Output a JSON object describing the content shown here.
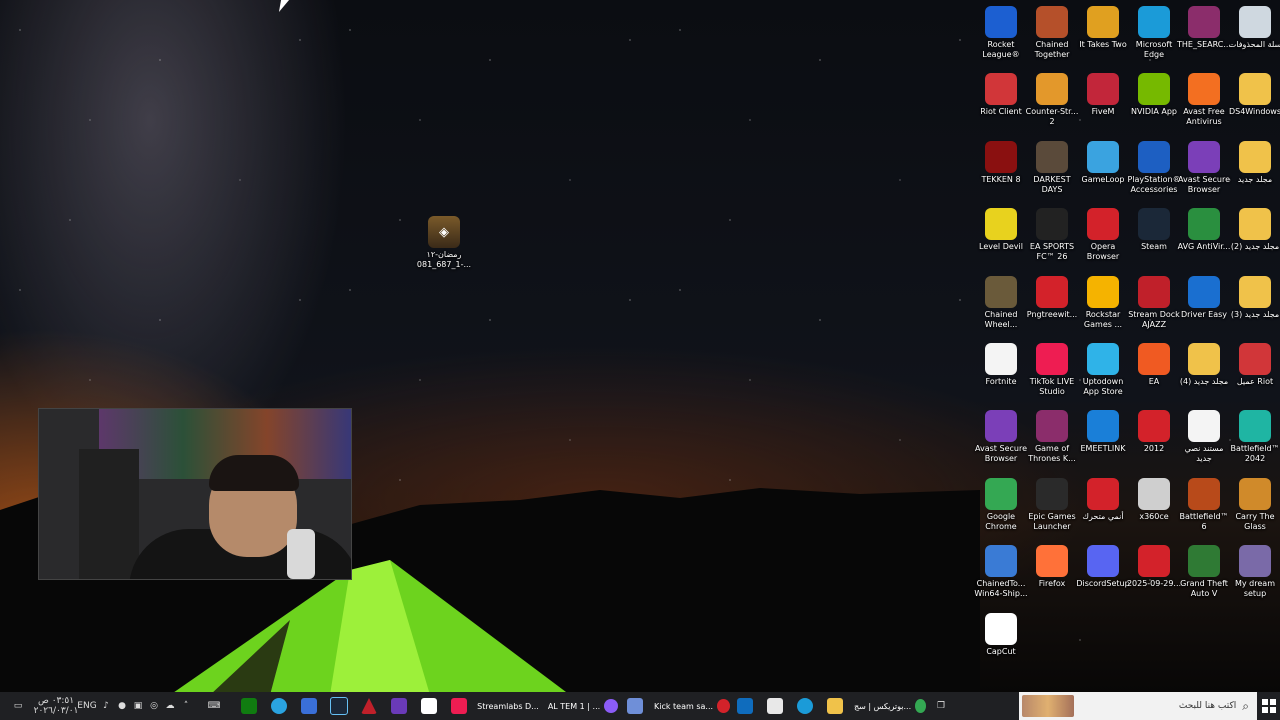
{
  "desktop": {
    "center_file": {
      "label": "رمضان-١٢ -1_687_081...",
      "icon": "image-file-icon"
    },
    "icons": [
      {
        "label": "Rocket League®",
        "icon": "rocket-league-icon",
        "color": "#1c5fd1"
      },
      {
        "label": "Chained Together",
        "icon": "chained-together-icon",
        "color": "#b5502a"
      },
      {
        "label": "It Takes Two",
        "icon": "it-takes-two-icon",
        "color": "#e0a020"
      },
      {
        "label": "Microsoft Edge",
        "icon": "edge-icon",
        "color": "#1b9bd8"
      },
      {
        "label": "THE_SEARC...",
        "icon": "winrar-archive-icon",
        "color": "#8b2d6b"
      },
      {
        "label": "سلة المحذوفات",
        "icon": "recycle-bin-icon",
        "color": "#cfd8e0"
      },
      {
        "label": "Riot Client",
        "icon": "riot-client-icon",
        "color": "#d13639"
      },
      {
        "label": "Counter-Str... 2",
        "icon": "counter-strike-icon",
        "color": "#e3982b"
      },
      {
        "label": "FiveM",
        "icon": "fivem-icon",
        "color": "#c2263a"
      },
      {
        "label": "NVIDIA App",
        "icon": "nvidia-icon",
        "color": "#76b900"
      },
      {
        "label": "Avast Free Antivirus",
        "icon": "avast-icon",
        "color": "#f36f21"
      },
      {
        "label": "DS4Windows",
        "icon": "folder-icon",
        "color": "#f0c24a"
      },
      {
        "label": "TEKKEN 8",
        "icon": "tekken-icon",
        "color": "#8a1010"
      },
      {
        "label": "DARKEST DAYS",
        "icon": "darkest-days-icon",
        "color": "#5a4a3a"
      },
      {
        "label": "GameLoop",
        "icon": "gameloop-icon",
        "color": "#3aa3e0"
      },
      {
        "label": "PlayStation® Accessories",
        "icon": "playstation-icon",
        "color": "#1d5fc2"
      },
      {
        "label": "Avast Secure Browser",
        "icon": "avast-browser-icon",
        "color": "#7b3fb8"
      },
      {
        "label": "مجلد جديد",
        "icon": "folder-icon",
        "color": "#f0c24a"
      },
      {
        "label": "Level Devil",
        "icon": "level-devil-icon",
        "color": "#e8d21e"
      },
      {
        "label": "EA SPORTS FC™ 26",
        "icon": "ea-fc-icon",
        "color": "#222222"
      },
      {
        "label": "Opera Browser",
        "icon": "opera-icon",
        "color": "#d3222a"
      },
      {
        "label": "Steam",
        "icon": "steam-icon",
        "color": "#1b2838"
      },
      {
        "label": "AVG AntiVir...",
        "icon": "avg-icon",
        "color": "#2a8f3f"
      },
      {
        "label": "مجلد جديد (2)",
        "icon": "folder-icon",
        "color": "#f0c24a"
      },
      {
        "label": "Chained Wheel...",
        "icon": "chained-wheel-icon",
        "color": "#6a5a3a"
      },
      {
        "label": "Pngtreewit...",
        "icon": "opera-icon",
        "color": "#d3222a"
      },
      {
        "label": "Rockstar Games ...",
        "icon": "rockstar-icon",
        "color": "#f5b300"
      },
      {
        "label": "Stream Dock AJAZZ",
        "icon": "stream-dock-icon",
        "color": "#c0202a"
      },
      {
        "label": "Driver Easy",
        "icon": "driver-easy-icon",
        "color": "#1a6fd0"
      },
      {
        "label": "مجلد جديد (3)",
        "icon": "folder-icon",
        "color": "#f0c24a"
      },
      {
        "label": "Fortnite",
        "icon": "blank-file-icon",
        "color": "#f4f4f4"
      },
      {
        "label": "TikTok LIVE Studio",
        "icon": "tiktok-icon",
        "color": "#ee1d52"
      },
      {
        "label": "Uptodown App Store",
        "icon": "uptodown-icon",
        "color": "#2fb3e8"
      },
      {
        "label": "EA",
        "icon": "ea-icon",
        "color": "#f05a22"
      },
      {
        "label": "مجلد جديد (4)",
        "icon": "folder-icon",
        "color": "#f0c24a"
      },
      {
        "label": "عميل Riot",
        "icon": "riot-client-icon",
        "color": "#d13639"
      },
      {
        "label": "Avast Secure Browser",
        "icon": "avast-browser-icon",
        "color": "#7b3fb8"
      },
      {
        "label": "Game of Thrones K...",
        "icon": "winrar-archive-icon",
        "color": "#8b2d6b"
      },
      {
        "label": "EMEETLINK",
        "icon": "emeetlink-icon",
        "color": "#1a7fd8"
      },
      {
        "label": "2012",
        "icon": "opera-icon",
        "color": "#d3222a"
      },
      {
        "label": "مستند نصي جديد",
        "icon": "text-file-icon",
        "color": "#f4f4f4"
      },
      {
        "label": "Battlefield™ 2042",
        "icon": "battlefield-2042-icon",
        "color": "#1fb5a3"
      },
      {
        "label": "Google Chrome",
        "icon": "chrome-icon",
        "color": "#34a853"
      },
      {
        "label": "Epic Games Launcher",
        "icon": "epic-games-icon",
        "color": "#2a2a2a"
      },
      {
        "label": "أنمي متحرك",
        "icon": "opera-icon",
        "color": "#d3222a"
      },
      {
        "label": "x360ce",
        "icon": "gamepad-icon",
        "color": "#cfcfcf"
      },
      {
        "label": "Battlefield™ 6",
        "icon": "battlefield-6-icon",
        "color": "#b84a1a"
      },
      {
        "label": "Carry The Glass",
        "icon": "carry-the-glass-icon",
        "color": "#d08a2a"
      },
      {
        "label": "ChainedTo... Win64-Ship...",
        "icon": "exe-file-icon",
        "color": "#3a7bd5"
      },
      {
        "label": "Firefox",
        "icon": "firefox-icon",
        "color": "#ff7139"
      },
      {
        "label": "DiscordSetup",
        "icon": "discord-icon",
        "color": "#5865f2"
      },
      {
        "label": "2025-09-29...",
        "icon": "opera-icon",
        "color": "#d3222a"
      },
      {
        "label": "Grand Theft Auto V",
        "icon": "gta-v-icon",
        "color": "#2f7a34"
      },
      {
        "label": "My dream setup",
        "icon": "image-file-icon",
        "color": "#7a6aa8"
      },
      {
        "label": "CapCut",
        "icon": "capcut-icon",
        "color": "#ffffff"
      }
    ]
  },
  "taskbar": {
    "clock_time": "٠٣:٥١ ص",
    "clock_date": "٢٠٢٦/٠٣/٠١",
    "lang": "ENG",
    "search_placeholder": "اكتب هنا للبحث",
    "running_labels": {
      "streamlabs": "Streamlabs D...",
      "al_team": "AL TEM 1 | ...",
      "kick": "Kick team sa...",
      "browser": "بوتريكس | سج..."
    }
  }
}
